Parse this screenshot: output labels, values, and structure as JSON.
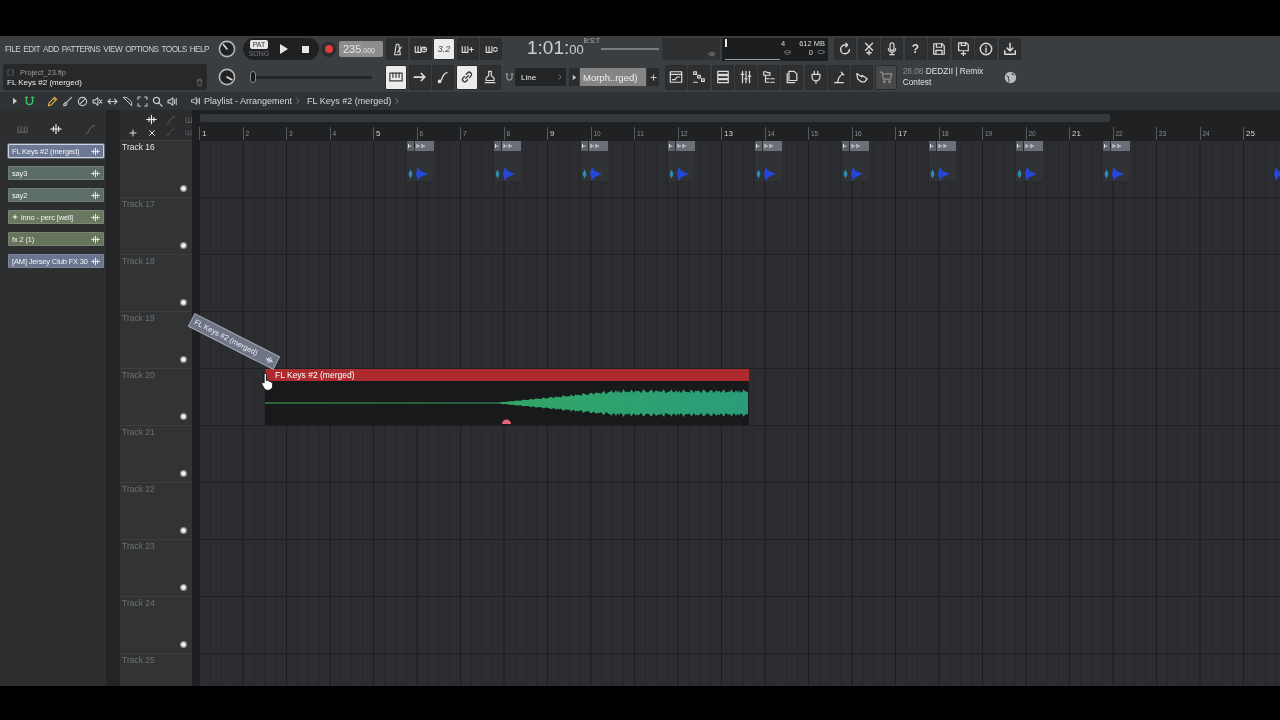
{
  "menu": [
    "FILE",
    "EDIT",
    "ADD",
    "PATTERNS",
    "VIEW",
    "OPTIONS",
    "TOOLS",
    "HELP"
  ],
  "project": {
    "file": "Project_23.flp",
    "selection": "FL Keys #2 (merged)"
  },
  "transport": {
    "modes": [
      {
        "label": "PAT",
        "selected": true
      },
      {
        "label": "SONG",
        "selected": false
      }
    ]
  },
  "tempo": {
    "whole": "235",
    "fraction": ".000"
  },
  "record_buttons": [
    {
      "kind": "metronome",
      "on": false
    },
    {
      "kind": "wait",
      "on": false
    },
    {
      "kind": "countdown",
      "label": "3.2",
      "on": true
    },
    {
      "kind": "blend",
      "on": false
    },
    {
      "kind": "loop",
      "on": false
    }
  ],
  "time": {
    "readout": "1:01:",
    "ticks": "00",
    "format": "B:S:T"
  },
  "monitor": {
    "polyphony": "4",
    "memory": "612 MB",
    "cpu": "0",
    "meter": {
      "level": 0.55
    }
  },
  "app_buttons": [
    {
      "kind": "undo"
    },
    {
      "kind": "cut"
    },
    {
      "kind": "mic"
    },
    {
      "kind": "help",
      "label": "?"
    },
    {
      "kind": "save"
    },
    {
      "kind": "saveas"
    },
    {
      "kind": "info"
    },
    {
      "kind": "export"
    }
  ],
  "position_slider": {
    "level": 0
  },
  "edit_buttons": [
    {
      "kind": "keyboard",
      "on": true
    },
    {
      "kind": "arrow",
      "on": false
    },
    {
      "kind": "stepedit",
      "on": false
    },
    {
      "kind": "link",
      "on": true
    },
    {
      "kind": "stamp",
      "on": false
    }
  ],
  "snap": {
    "value": "Line"
  },
  "pattern": {
    "value": "Morph..rged)"
  },
  "window_buttons": [
    {
      "kind": "playlist",
      "disabled": false
    },
    {
      "kind": "rack",
      "disabled": false
    },
    {
      "kind": "mixerlist",
      "disabled": false
    },
    {
      "kind": "mixer",
      "disabled": false
    },
    {
      "kind": "browser",
      "disabled": false
    },
    {
      "kind": "files",
      "disabled": false
    },
    {
      "kind": "plugin",
      "disabled": false
    },
    {
      "kind": "tuner",
      "disabled": false
    },
    {
      "kind": "hand",
      "disabled": false
    },
    {
      "kind": "cart",
      "disabled": true
    }
  ],
  "news": {
    "date": "28.08",
    "headline": "DEDZII | Remix Contest"
  },
  "snap_toggle": {
    "on": true
  },
  "tools": [
    {
      "kind": "pencil",
      "selected": true
    },
    {
      "kind": "brush",
      "selected": false
    },
    {
      "kind": "delete",
      "selected": false
    },
    {
      "kind": "mute",
      "selected": false
    },
    {
      "kind": "slip",
      "selected": false
    },
    {
      "kind": "slice",
      "selected": false
    },
    {
      "kind": "select",
      "selected": false
    },
    {
      "kind": "zoom",
      "selected": false
    },
    {
      "kind": "playback",
      "selected": false
    }
  ],
  "breadcrumb": [
    "Playlist - Arrangement",
    "FL Keys #2 (merged)"
  ],
  "picker": {
    "items": [
      {
        "label": "FL Keys #2 (merged)",
        "color": "#6d7994",
        "selected": true,
        "marked": false
      },
      {
        "label": "say3",
        "color": "#5b6b67",
        "selected": false,
        "marked": false
      },
      {
        "label": "say2",
        "color": "#5d6d69",
        "selected": false,
        "marked": false
      },
      {
        "label": "inno - perc [well]",
        "color": "#6a7860",
        "selected": false,
        "marked": true
      },
      {
        "label": "fx 2 (1)",
        "color": "#66745c",
        "selected": false,
        "marked": false
      },
      {
        "label": "[AM] Jersey Club FX 30",
        "color": "#6b7590",
        "selected": false,
        "marked": false
      }
    ]
  },
  "ruler": [
    {
      "label": "1",
      "major": true
    },
    {
      "label": "2",
      "major": false
    },
    {
      "label": "3",
      "major": false
    },
    {
      "label": "4",
      "major": false
    },
    {
      "label": "5",
      "major": true
    },
    {
      "label": "6",
      "major": false
    },
    {
      "label": "7",
      "major": false
    },
    {
      "label": "8",
      "major": false
    },
    {
      "label": "9",
      "major": true
    },
    {
      "label": "10",
      "major": false
    },
    {
      "label": "11",
      "major": false
    },
    {
      "label": "12",
      "major": false
    },
    {
      "label": "13",
      "major": true
    },
    {
      "label": "14",
      "major": false
    },
    {
      "label": "15",
      "major": false
    },
    {
      "label": "16",
      "major": false
    },
    {
      "label": "17",
      "major": true
    },
    {
      "label": "18",
      "major": false
    },
    {
      "label": "19",
      "major": false
    },
    {
      "label": "20",
      "major": false
    },
    {
      "label": "21",
      "major": true
    },
    {
      "label": "22",
      "major": false
    },
    {
      "label": "23",
      "major": false
    },
    {
      "label": "24",
      "major": false
    },
    {
      "label": "25",
      "major": true
    }
  ],
  "tracks": [
    {
      "label": "Track 16",
      "selected": true,
      "kind": "clips"
    },
    {
      "label": "Track 17",
      "selected": false,
      "kind": "empty"
    },
    {
      "label": "Track 18",
      "selected": false,
      "kind": "empty"
    },
    {
      "label": "Track 19",
      "selected": false,
      "kind": "empty"
    },
    {
      "label": "Track 20",
      "selected": false,
      "kind": "audio",
      "clip": "FL Keys #2 (merged)"
    },
    {
      "label": "Track 21",
      "selected": false,
      "kind": "empty"
    },
    {
      "label": "Track 22",
      "selected": false,
      "kind": "empty"
    },
    {
      "label": "Track 23",
      "selected": false,
      "kind": "empty"
    },
    {
      "label": "Track 24",
      "selected": false,
      "kind": "empty"
    },
    {
      "label": "Track 25",
      "selected": false,
      "kind": "empty"
    }
  ],
  "drag_ghost": {
    "label": "FL Keys #2 (merged)"
  }
}
